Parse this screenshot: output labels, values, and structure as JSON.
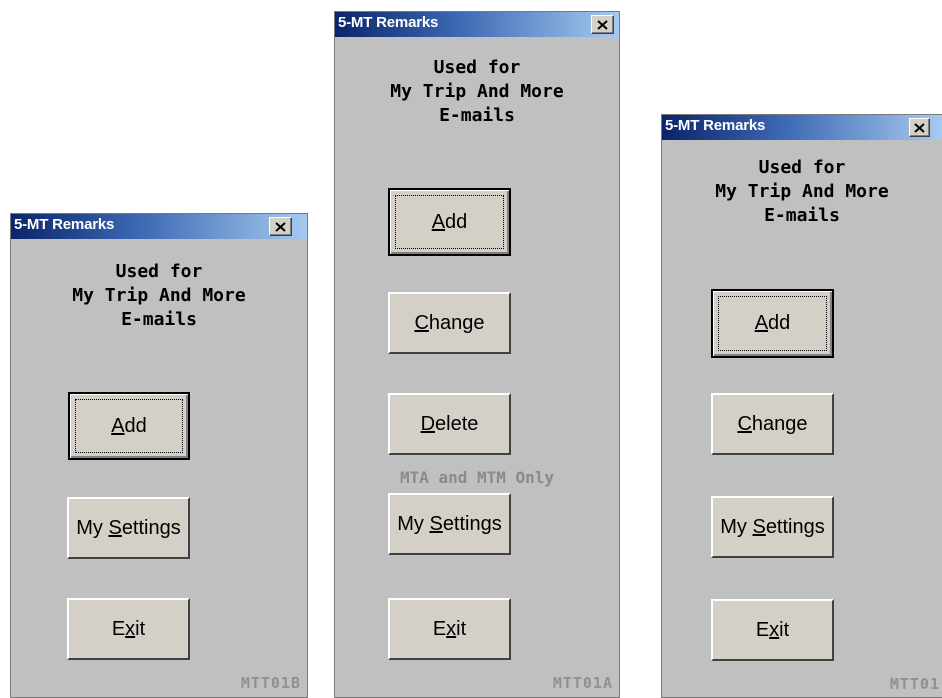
{
  "dialogs": [
    {
      "title": "5-MT Remarks",
      "desc_lines": [
        "Used for",
        "My Trip And More",
        "E-mails"
      ],
      "buttons": {
        "add": {
          "pre": "",
          "key": "A",
          "post": "dd"
        },
        "settings": {
          "pre": "My ",
          "key": "S",
          "post": "ettings"
        },
        "exit": {
          "pre": "E",
          "key": "x",
          "post": "it"
        }
      },
      "code": "MTT01B"
    },
    {
      "title": "5-MT Remarks",
      "desc_lines": [
        "Used for",
        "My Trip And More",
        "E-mails"
      ],
      "buttons": {
        "add": {
          "pre": "",
          "key": "A",
          "post": "dd"
        },
        "change": {
          "pre": "",
          "key": "C",
          "post": "hange"
        },
        "delete": {
          "pre": "",
          "key": "D",
          "post": "elete"
        },
        "settings": {
          "pre": "My ",
          "key": "S",
          "post": "ettings"
        },
        "exit": {
          "pre": "E",
          "key": "x",
          "post": "it"
        }
      },
      "note": "MTA and MTM Only",
      "code": "MTT01A"
    },
    {
      "title": "5-MT Remarks",
      "desc_lines": [
        "Used for",
        "My Trip And More",
        "E-mails"
      ],
      "buttons": {
        "add": {
          "pre": "",
          "key": "A",
          "post": "dd"
        },
        "change": {
          "pre": "",
          "key": "C",
          "post": "hange"
        },
        "settings": {
          "pre": "My ",
          "key": "S",
          "post": "ettings"
        },
        "exit": {
          "pre": "E",
          "key": "x",
          "post": "it"
        }
      },
      "code": "MTT01"
    }
  ],
  "icons": {
    "close": "close-x-icon"
  },
  "colors": {
    "title_start": "#0a246a",
    "title_end": "#a6caf0",
    "face": "#c0c0c0",
    "button": "#d4d0c8",
    "note": "#8a8a8a"
  }
}
